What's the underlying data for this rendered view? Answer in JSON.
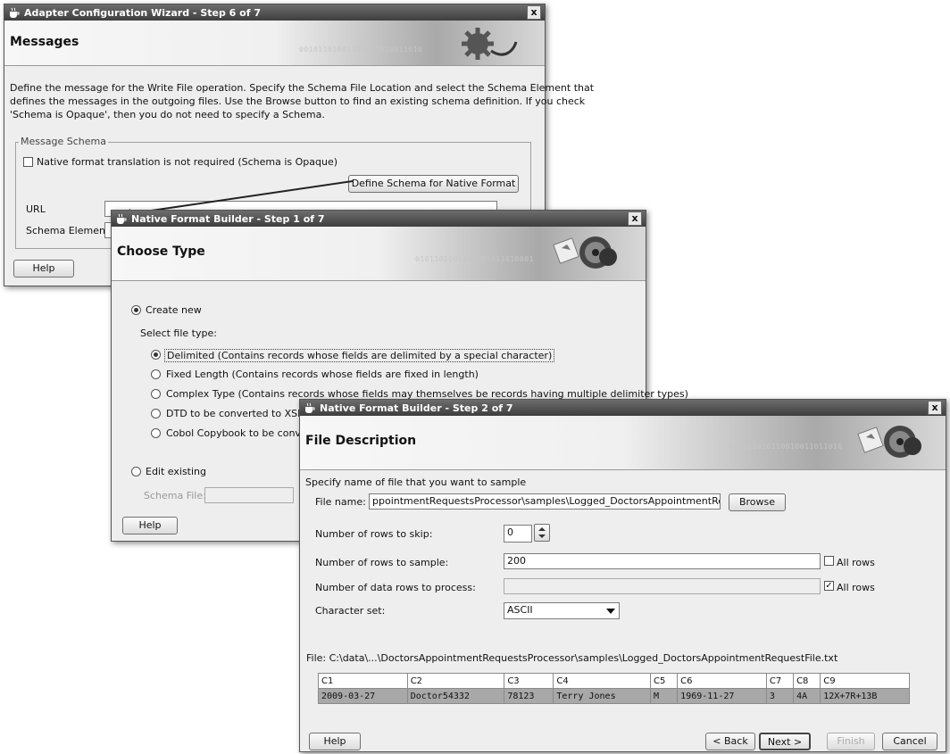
{
  "adapter": {
    "title": "Adapter Configuration Wizard - Step 6 of 7",
    "close": "x",
    "header": "Messages",
    "description_lines": [
      "Define the message for the Write File operation.  Specify the Schema File Location and select the Schema Element that",
      "defines the messages in the outgoing files. Use the Browse button to find an existing schema definition. If you check",
      "'Schema is Opaque', then you do not need to specify a Schema."
    ],
    "legend": "Message Schema",
    "opaque_label": "Native format translation is not required (Schema is Opaque)",
    "define_schema_label": "Define Schema for Native Format",
    "url_label": "URL",
    "schema_element_label": "Schema Element",
    "help_label": "Help"
  },
  "step1": {
    "title": "Native Format Builder - Step 1 of 7",
    "close": "x",
    "header": "Choose Type",
    "create_new_label": "Create new",
    "select_type_label": "Select file type:",
    "types": [
      "Delimited (Contains records whose fields are delimited by a special character)",
      "Fixed Length (Contains records whose fields are fixed in length)",
      "Complex Type (Contains records whose fields may themselves be records having multiple delimiter types)",
      "DTD to be converted to XSD",
      "Cobol Copybook to be convert"
    ],
    "edit_existing_label": "Edit existing",
    "schema_file_label": "Schema File:",
    "help_label": "Help"
  },
  "step2": {
    "title": "Native Format Builder - Step 2 of 7",
    "close": "x",
    "header": "File Description",
    "intro": "Specify name of file that you want to sample",
    "file_name_label": "File name:",
    "file_name_value": "ppointmentRequestsProcessor\\samples\\Logged_DoctorsAppointmentRequestFile.t",
    "browse_label": "Browse",
    "rows_skip_label": "Number of rows to skip:",
    "rows_skip_value": "0",
    "rows_sample_label": "Number of rows to sample:",
    "rows_sample_value": "200",
    "all_rows_label": "All rows",
    "rows_process_label": "Number of data rows to process:",
    "rows_process_all_label": "All rows",
    "charset_label": "Character set:",
    "charset_value": "ASCII",
    "file_path": "File: C:\\data\\...\\DoctorsAppointmentRequestsProcessor\\samples\\Logged_DoctorsAppointmentRequestFile.txt",
    "columns": [
      "C1",
      "C2",
      "C3",
      "C4",
      "C5",
      "C6",
      "C7",
      "C8",
      "C9"
    ],
    "row": [
      "2009-03-27",
      "Doctor54332",
      "78123",
      "Terry Jones",
      "M",
      "1969-11-27",
      "3",
      "4A",
      "12X+7R+13B"
    ],
    "help_label": "Help",
    "back_label": "< Back",
    "next_label": "Next >",
    "finish_label": "Finish",
    "cancel_label": "Cancel"
  },
  "header_binary_a": "00101101001101010010011010",
  "header_binary_b": "0101101001101001011010001",
  "header_binary_c": "001011010110010011011010"
}
